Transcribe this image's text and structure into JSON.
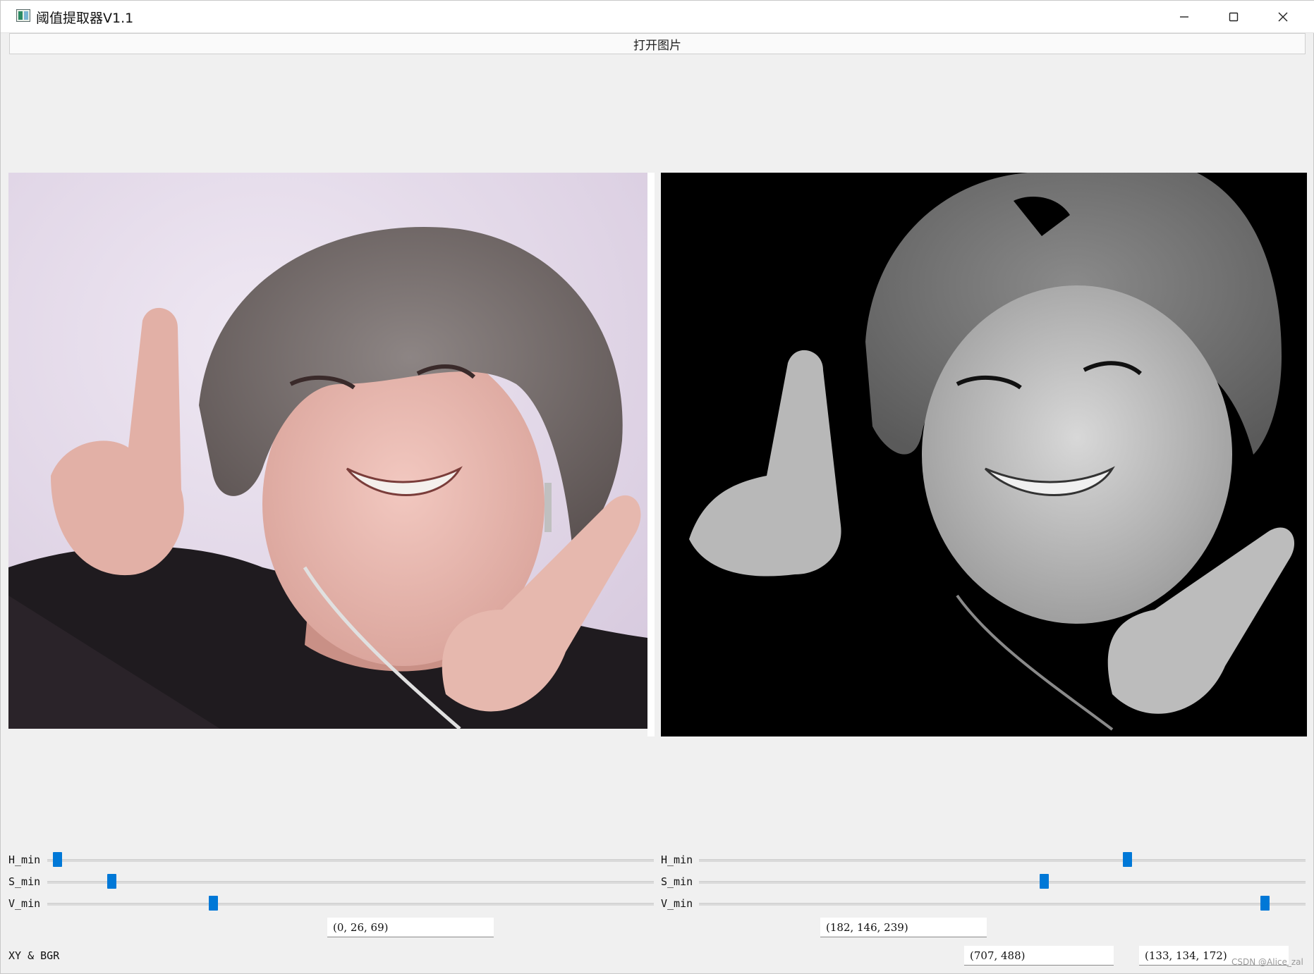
{
  "window": {
    "title": "阈值提取器V1.1",
    "controls": {
      "minimize": "minimize-icon",
      "maximize": "maximize-icon",
      "close": "close-icon"
    }
  },
  "toolbar": {
    "open_image_label": "打开图片"
  },
  "images": {
    "original": "photo of a young man pointing with both hands",
    "mask": "thresholded grayscale result on black background"
  },
  "left_panel": {
    "sliders": [
      {
        "label": "H_min",
        "level": 0.01
      },
      {
        "label": "S_min",
        "level": 0.1
      },
      {
        "label": "V_min",
        "level": 0.27
      }
    ],
    "value_display": "(0, 26, 69)"
  },
  "right_panel": {
    "sliders": [
      {
        "label": "H_min",
        "level": 0.71
      },
      {
        "label": "S_min",
        "level": 0.57
      },
      {
        "label": "V_min",
        "level": 0.94
      }
    ],
    "value_display": "(182, 146, 239)"
  },
  "xy_bgr": {
    "label": "XY & BGR",
    "xy_value": "(707,  488)",
    "bgr_value": "(133,  134, 172)"
  },
  "watermark": "CSDN @Alice_zal",
  "colors": {
    "slider_handle": "#0078d7",
    "background": "#f0f0f0"
  }
}
